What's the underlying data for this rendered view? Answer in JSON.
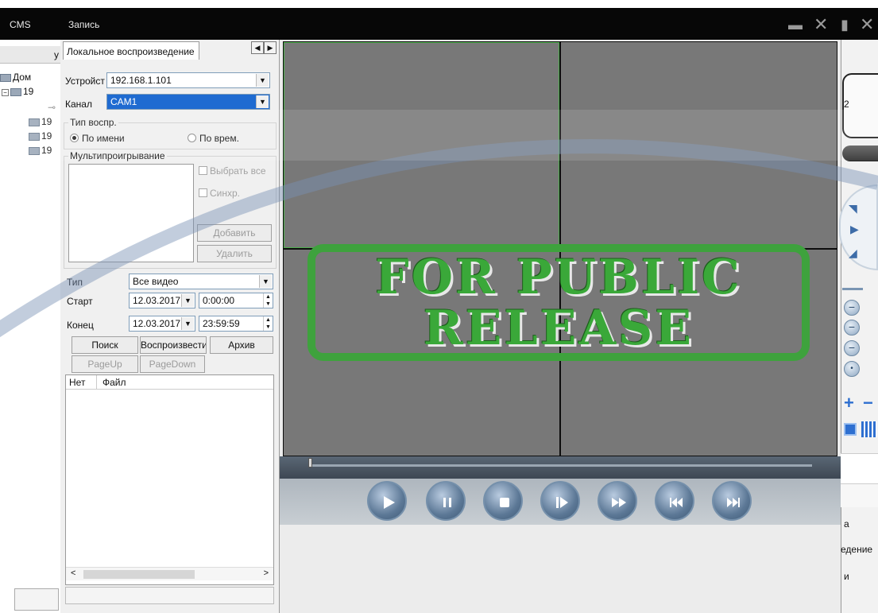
{
  "title_bar": {
    "app_title": "CMS",
    "window_title": "Запись"
  },
  "cms": {
    "tab_fragment": "у",
    "tree": [
      {
        "label": "Дом"
      },
      {
        "label": "19"
      },
      {
        "label": "19"
      },
      {
        "label": "19"
      },
      {
        "label": "19"
      }
    ]
  },
  "dialog": {
    "tab_label": "Локальное воспроизведение",
    "device_label": "Устройство",
    "device_value": "192.168.1.101",
    "channel_label": "Канал",
    "channel_value": "CAM1",
    "playback_type_group": "Тип воспр.",
    "by_name_label": "По имени",
    "by_time_label": "По врем.",
    "multiplay_group": "Мультипроигрывание",
    "select_all_label": "Выбрать все",
    "sync_label": "Синхр.",
    "add_button": "Добавить",
    "delete_button": "Удалить",
    "type_label": "Тип",
    "type_value": "Все видео",
    "start_label": "Старт",
    "start_date": "12.03.2017",
    "start_time": "0:00:00",
    "end_label": "Конец",
    "end_date": "12.03.2017",
    "end_time": "23:59:59",
    "search_button": "Поиск",
    "play_button": "Воспроизвести",
    "archive_button": "Архив",
    "pageup_button": "PageUp",
    "pagedown_button": "PageDown",
    "list_headers": [
      "Нет",
      "Файл"
    ]
  },
  "playback_controls": [
    "play-icon",
    "pause-icon",
    "stop-icon",
    "step-forward-icon",
    "fast-forward-icon",
    "previous-icon",
    "next-icon"
  ],
  "right_panel": {
    "label_2": "2",
    "label_a": "а",
    "label_vedenie": "едение",
    "label_i": "и"
  },
  "watermark": {
    "line1": "FOR PUBLIC",
    "line2": "RELEASE"
  },
  "colors": {
    "title_bar": "#070707",
    "selection": "#1f6bd1",
    "stamp_green": "#3ea23d",
    "video_cell": "#787878",
    "active_cell_border": "#4cae4c"
  }
}
